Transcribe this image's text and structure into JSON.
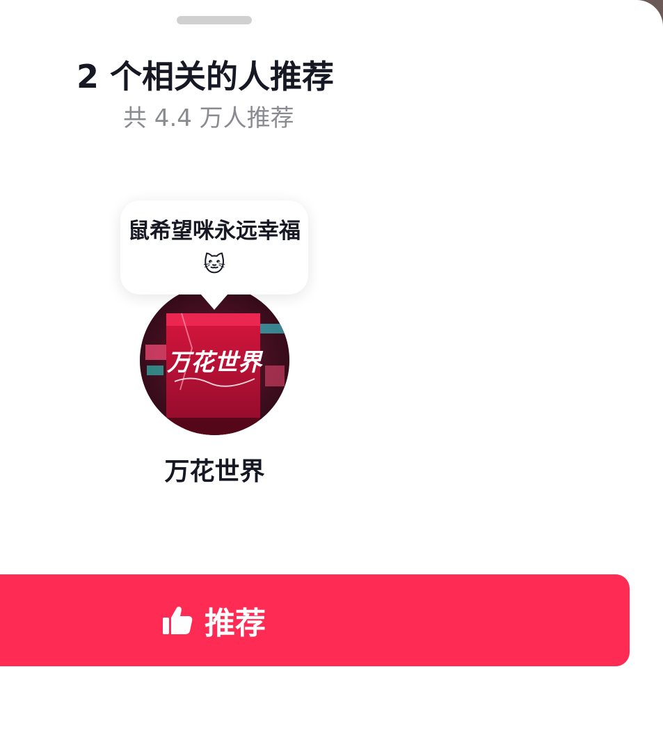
{
  "sheet": {
    "title": "2 个相关的人推荐",
    "subtitle": "共 4.4 万人推荐"
  },
  "recommender": {
    "comment": "鼠希望咪永远幸福🐱",
    "avatar_text": "万花世界",
    "name": "万花世界"
  },
  "actions": {
    "recommend_label": "推荐",
    "recommend_icon": "thumbs-up-icon"
  },
  "colors": {
    "accent": "#fe2c55",
    "title": "#161823",
    "subtitle": "#8a8b91",
    "handle": "#d0d0d0"
  }
}
